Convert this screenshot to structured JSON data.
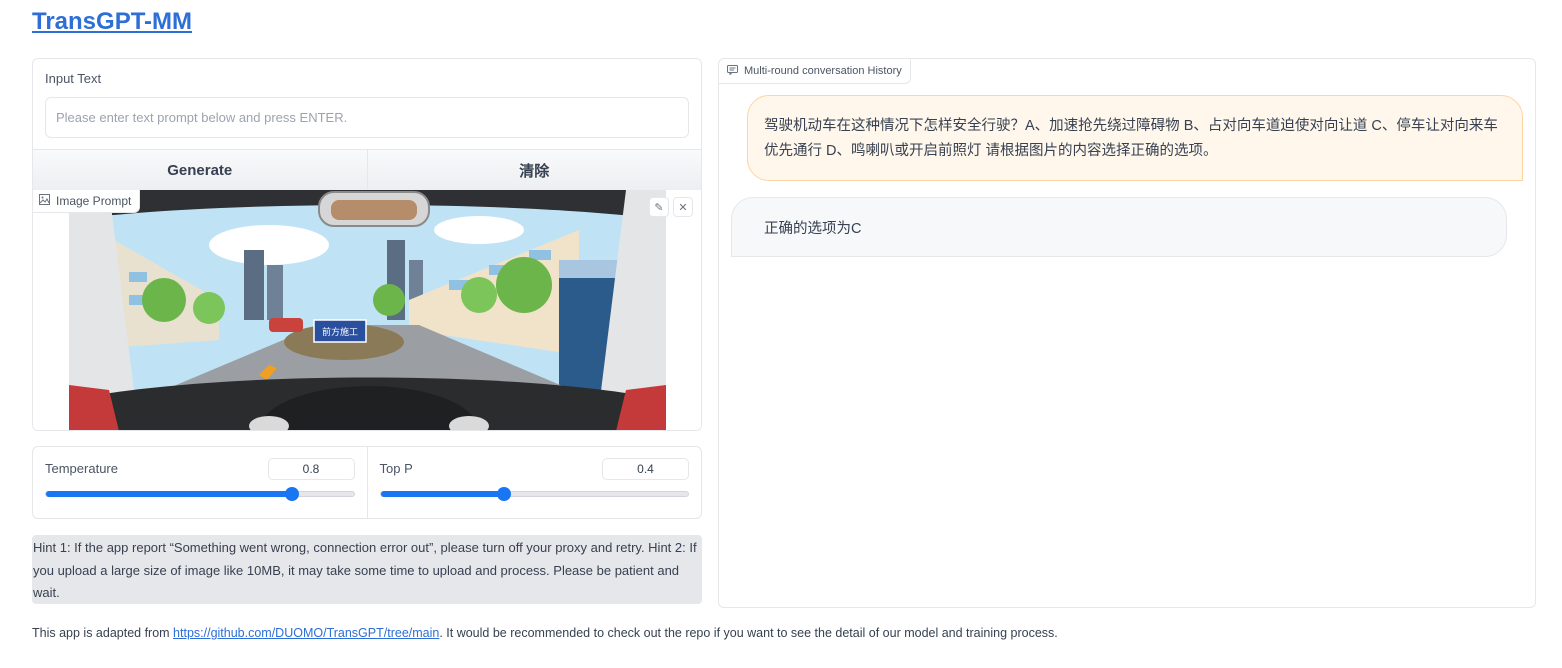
{
  "app": {
    "title": "TransGPT-MM"
  },
  "input": {
    "label": "Input Text",
    "placeholder": "Please enter text prompt below and press ENTER.",
    "value": ""
  },
  "buttons": {
    "generate": "Generate",
    "clear": "清除"
  },
  "image_prompt": {
    "label": "Image Prompt",
    "edit_icon": "pencil-icon",
    "close_icon": "close-icon",
    "sign_text": "前方施工"
  },
  "sliders": {
    "temperature": {
      "label": "Temperature",
      "value": "0.8",
      "fraction": 0.8
    },
    "top_p": {
      "label": "Top P",
      "value": "0.4",
      "fraction": 0.4
    }
  },
  "hint": "Hint 1: If the app report “Something went wrong, connection error out”, please turn off your proxy and retry. Hint 2: If you upload a large size of image like 10MB, it may take some time to upload and process. Please be patient and wait.",
  "footer": {
    "prefix": "This app is adapted from ",
    "link": "https://github.com/DUOMO/TransGPT/tree/main",
    "suffix": ". It would be recommended to check out the repo if you want to see the detail of our model and training process."
  },
  "chat": {
    "label": "Multi-round conversation History",
    "messages": [
      {
        "role": "user",
        "text": "驾驶机动车在这种情况下怎样安全行驶？A、加速抢先绕过障碍物 B、占对向车道迫使对向让道 C、停车让对向来车优先通行 D、鸣喇叭或开启前照灯 请根据图片的内容选择正确的选项。"
      },
      {
        "role": "bot",
        "text": "正确的选项为C"
      }
    ]
  },
  "colors": {
    "accent": "#1876f2",
    "link": "#2d6fd6",
    "user_bubble": "#fff7ec",
    "user_border": "#fbd5a3",
    "bot_bubble": "#f7f8fa"
  }
}
